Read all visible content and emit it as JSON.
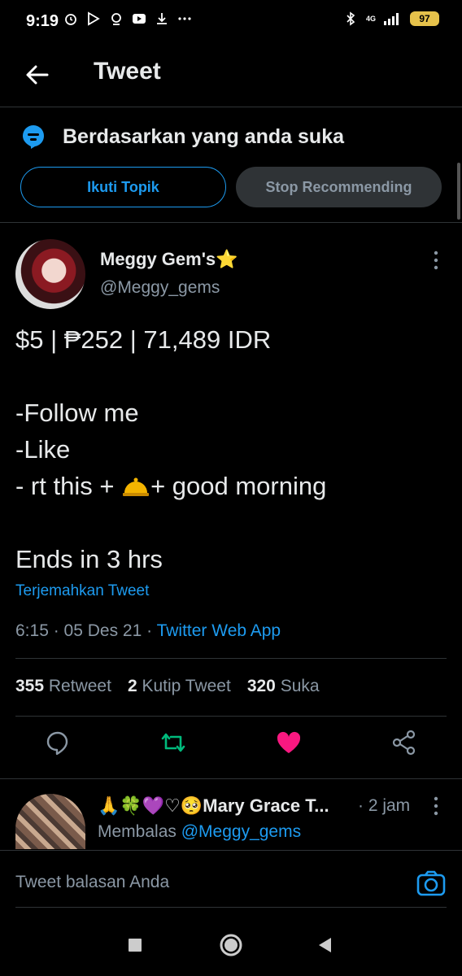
{
  "status_bar": {
    "time": "9:19",
    "network": "4G",
    "battery": "97"
  },
  "header": {
    "title": "Tweet"
  },
  "topic": {
    "label": "Berdasarkan yang anda suka",
    "follow_label": "Ikuti Topik",
    "stop_label": "Stop Recommending"
  },
  "tweet": {
    "author_name": "Meggy Gem's",
    "author_star": "⭐",
    "handle": "@Meggy_gems",
    "line1": "$5 | ₱252 | 71,489 IDR",
    "line2": "-Follow me",
    "line3": "-Like",
    "line4_pre": "- rt this + ",
    "line4_post": "+ good morning",
    "line5": "Ends in 3 hrs",
    "translate": "Terjemahkan Tweet",
    "time": "6:15",
    "date": "05 Des 21",
    "source": "Twitter Web App",
    "retweets": "355",
    "retweets_label": "Retweet",
    "quotes": "2",
    "quotes_label": "Kutip Tweet",
    "likes": "320",
    "likes_label": "Suka"
  },
  "reply": {
    "name": "🙏🍀💜♡🥺Mary Grace T...",
    "time": "· 2 jam",
    "replying_prefix": "Membalas",
    "replying_handle": "@Meggy_gems"
  },
  "compose": {
    "placeholder": "Tweet balasan Anda"
  },
  "colors": {
    "accent": "#1d9bf0",
    "like": "#f91880",
    "retweet": "#00ba7c"
  }
}
